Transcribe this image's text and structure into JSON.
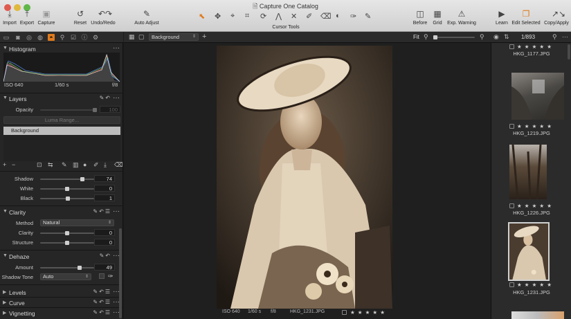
{
  "window": {
    "title": "Capture One Catalog"
  },
  "toolbar": {
    "import": "Import",
    "export": "Export",
    "capture": "Capture",
    "reset": "Reset",
    "undo_redo": "Undo/Redo",
    "auto_adjust": "Auto Adjust",
    "cursor_tools": "Cursor Tools",
    "before": "Before",
    "grid": "Grid",
    "exp_warning": "Exp. Warning",
    "learn": "Learn",
    "edit_selected": "Edit Selected",
    "copy_apply": "Copy/Apply"
  },
  "viewer_bar": {
    "variant_select": "Background",
    "fit": "Fit"
  },
  "browser_bar": {
    "count": "1/893"
  },
  "histogram": {
    "title": "Histogram",
    "iso": "ISO 640",
    "shutter": "1/60 s",
    "aperture": "f/8"
  },
  "layers": {
    "title": "Layers",
    "opacity_label": "Opacity",
    "opacity_value": "100",
    "luma_range": "Luma Range...",
    "layer_name": "Background"
  },
  "hdr_sliders": [
    {
      "label": "Shadow",
      "value": "74",
      "level": 0.8
    },
    {
      "label": "White",
      "value": "0",
      "level": 0.5
    },
    {
      "label": "Black",
      "value": "1",
      "level": 0.51
    }
  ],
  "clarity": {
    "title": "Clarity",
    "method_label": "Method",
    "method_value": "Natural",
    "sliders": [
      {
        "label": "Clarity",
        "value": "0",
        "level": 0.5
      },
      {
        "label": "Structure",
        "value": "0",
        "level": 0.5
      }
    ]
  },
  "dehaze": {
    "title": "Dehaze",
    "amount_label": "Amount",
    "amount_value": "49",
    "amount_level": 0.75,
    "shadow_tone_label": "Shadow Tone",
    "shadow_tone_value": "Auto"
  },
  "collapsed_tools": [
    {
      "title": "Levels"
    },
    {
      "title": "Curve"
    },
    {
      "title": "Vignetting"
    }
  ],
  "viewer_status": {
    "iso": "ISO 640",
    "shutter": "1/60 s",
    "aperture": "f/8",
    "filename": "HKG_1231.JPG",
    "stars": "★ ★ ★ ★ ★"
  },
  "thumbnails": [
    {
      "filename": "HKG_1177.JPG",
      "stars": "★ ★ ★ ★ ★"
    },
    {
      "filename": "HKG_1219.JPG",
      "stars": "★ ★ ★ ★ ★"
    },
    {
      "filename": "HKG_1226.JPG",
      "stars": "★ ★ ★ ★ ★"
    },
    {
      "filename": "HKG_1231.JPG",
      "stars": "★ ★ ★ ★ ★",
      "selected": true
    }
  ],
  "colors": {
    "accent": "#e07b1d",
    "panel": "#262626",
    "viewer": "#1f1f1f"
  }
}
